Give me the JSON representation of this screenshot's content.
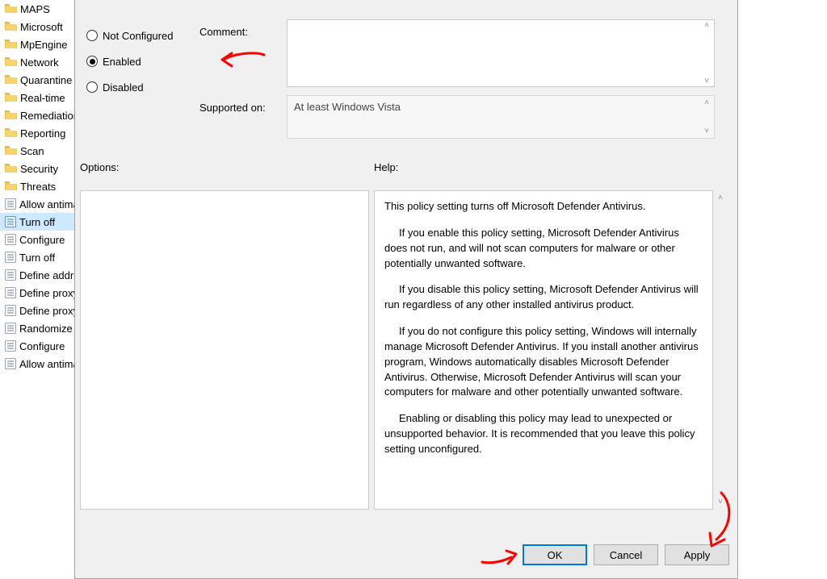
{
  "tree": {
    "items": [
      {
        "type": "folder",
        "label": "MAPS"
      },
      {
        "type": "folder",
        "label": "Microsoft"
      },
      {
        "type": "folder",
        "label": "MpEngine"
      },
      {
        "type": "folder",
        "label": "Network"
      },
      {
        "type": "folder",
        "label": "Quarantine"
      },
      {
        "type": "folder",
        "label": "Real-time"
      },
      {
        "type": "folder",
        "label": "Remediation"
      },
      {
        "type": "folder",
        "label": "Reporting"
      },
      {
        "type": "folder",
        "label": "Scan"
      },
      {
        "type": "folder",
        "label": "Security"
      },
      {
        "type": "folder",
        "label": "Threats"
      },
      {
        "type": "setting",
        "label": "Allow antimalware"
      },
      {
        "type": "setting",
        "label": "Turn off",
        "selected": true
      },
      {
        "type": "setting",
        "label": "Configure"
      },
      {
        "type": "setting",
        "label": "Turn off"
      },
      {
        "type": "setting",
        "label": "Define addresses"
      },
      {
        "type": "setting",
        "label": "Define proxy"
      },
      {
        "type": "setting",
        "label": "Define proxy"
      },
      {
        "type": "setting",
        "label": "Randomize"
      },
      {
        "type": "setting",
        "label": "Configure"
      },
      {
        "type": "setting",
        "label": "Allow antimalware"
      }
    ]
  },
  "dialog": {
    "radios": {
      "not_configured": "Not Configured",
      "enabled": "Enabled",
      "disabled": "Disabled",
      "selected": "enabled"
    },
    "comment_label": "Comment:",
    "comment_value": "",
    "supported_label": "Supported on:",
    "supported_value": "At least Windows Vista",
    "options_label": "Options:",
    "help_label": "Help:",
    "help_paragraphs": {
      "p0": "This policy setting turns off Microsoft Defender Antivirus.",
      "p1": "If you enable this policy setting, Microsoft Defender Antivirus does not run, and will not scan computers for malware or other potentially unwanted software.",
      "p2": "If you disable this policy setting, Microsoft Defender Antivirus will run regardless of any other installed antivirus product.",
      "p3": "If you do not configure this policy setting, Windows will internally manage Microsoft Defender Antivirus. If you install another antivirus program, Windows automatically disables Microsoft Defender Antivirus. Otherwise, Microsoft Defender Antivirus will scan your computers for malware and other potentially unwanted software.",
      "p4": "Enabling or disabling this policy may lead to unexpected or unsupported behavior. It is recommended that you leave this policy setting unconfigured."
    },
    "buttons": {
      "ok": "OK",
      "cancel": "Cancel",
      "apply": "Apply"
    }
  },
  "annotation_color": "#ff0000"
}
